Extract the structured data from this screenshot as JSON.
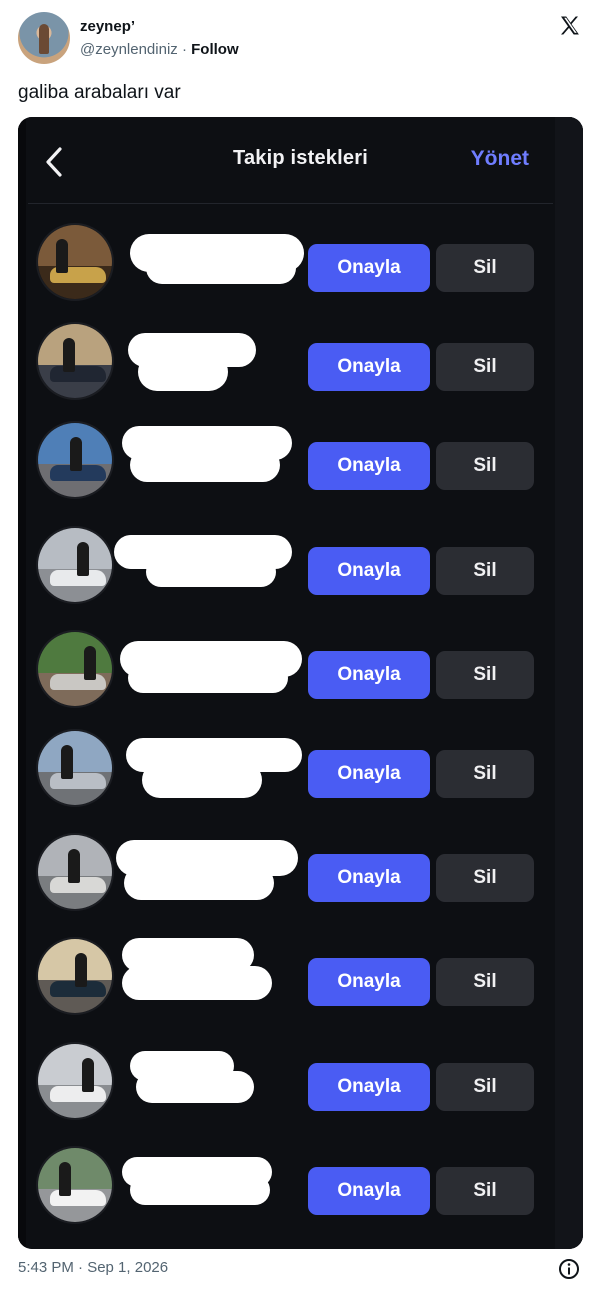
{
  "tweet": {
    "author_name": "zeynep’",
    "handle": "@zeynlendiniz",
    "separator": " · ",
    "follow_label": "Follow",
    "text": "galiba arabaları var",
    "timestamp": "5:43 PM · Sep 1, 2026"
  },
  "screenshot": {
    "title": "Takip istekleri",
    "manage_label": "Yönet",
    "accent_color": "#4a5cf3",
    "requests": [
      {
        "approve_label": "Onayla",
        "delete_label": "Sil"
      },
      {
        "approve_label": "Onayla",
        "delete_label": "Sil"
      },
      {
        "approve_label": "Onayla",
        "delete_label": "Sil"
      },
      {
        "approve_label": "Onayla",
        "delete_label": "Sil"
      },
      {
        "approve_label": "Onayla",
        "delete_label": "Sil"
      },
      {
        "approve_label": "Onayla",
        "delete_label": "Sil"
      },
      {
        "approve_label": "Onayla",
        "delete_label": "Sil"
      },
      {
        "approve_label": "Onayla",
        "delete_label": "Sil"
      },
      {
        "approve_label": "Onayla",
        "delete_label": "Sil"
      },
      {
        "approve_label": "Onayla",
        "delete_label": "Sil"
      }
    ]
  }
}
